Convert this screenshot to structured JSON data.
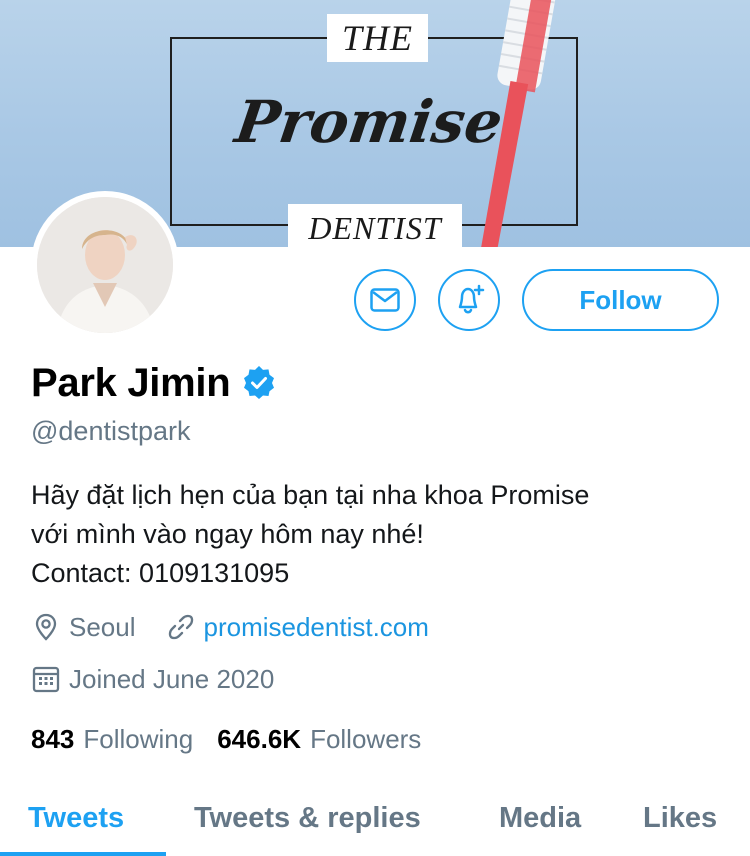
{
  "banner": {
    "the": "THE",
    "promise": "Promise",
    "dentist": "DENTIST"
  },
  "profile": {
    "name": "Park Jimin",
    "handle": "@dentistpark",
    "bio_lines": [
      "Hãy đặt lịch hẹn của bạn tại nha khoa Promise",
      "với mình vào ngay hôm nay nhé!",
      "Contact: 0109131095"
    ],
    "location": "Seoul",
    "website": "promisedentist.com",
    "joined": "Joined June 2020",
    "following_count": "843",
    "following_label": "Following",
    "followers_count": "646.6K",
    "followers_label": "Followers"
  },
  "actions": {
    "follow_label": "Follow",
    "message_icon": "envelope-icon",
    "notify_icon": "bell-plus-icon"
  },
  "tabs": [
    {
      "label": "Tweets",
      "active": true
    },
    {
      "label": "Tweets & replies",
      "active": false
    },
    {
      "label": "Media",
      "active": false
    },
    {
      "label": "Likes",
      "active": false
    }
  ],
  "colors": {
    "accent": "#1da1f2",
    "secondary_text": "#657786",
    "link": "#1b95e0",
    "banner_bg": "#a9c8e5",
    "toothbrush": "#e9525b"
  }
}
